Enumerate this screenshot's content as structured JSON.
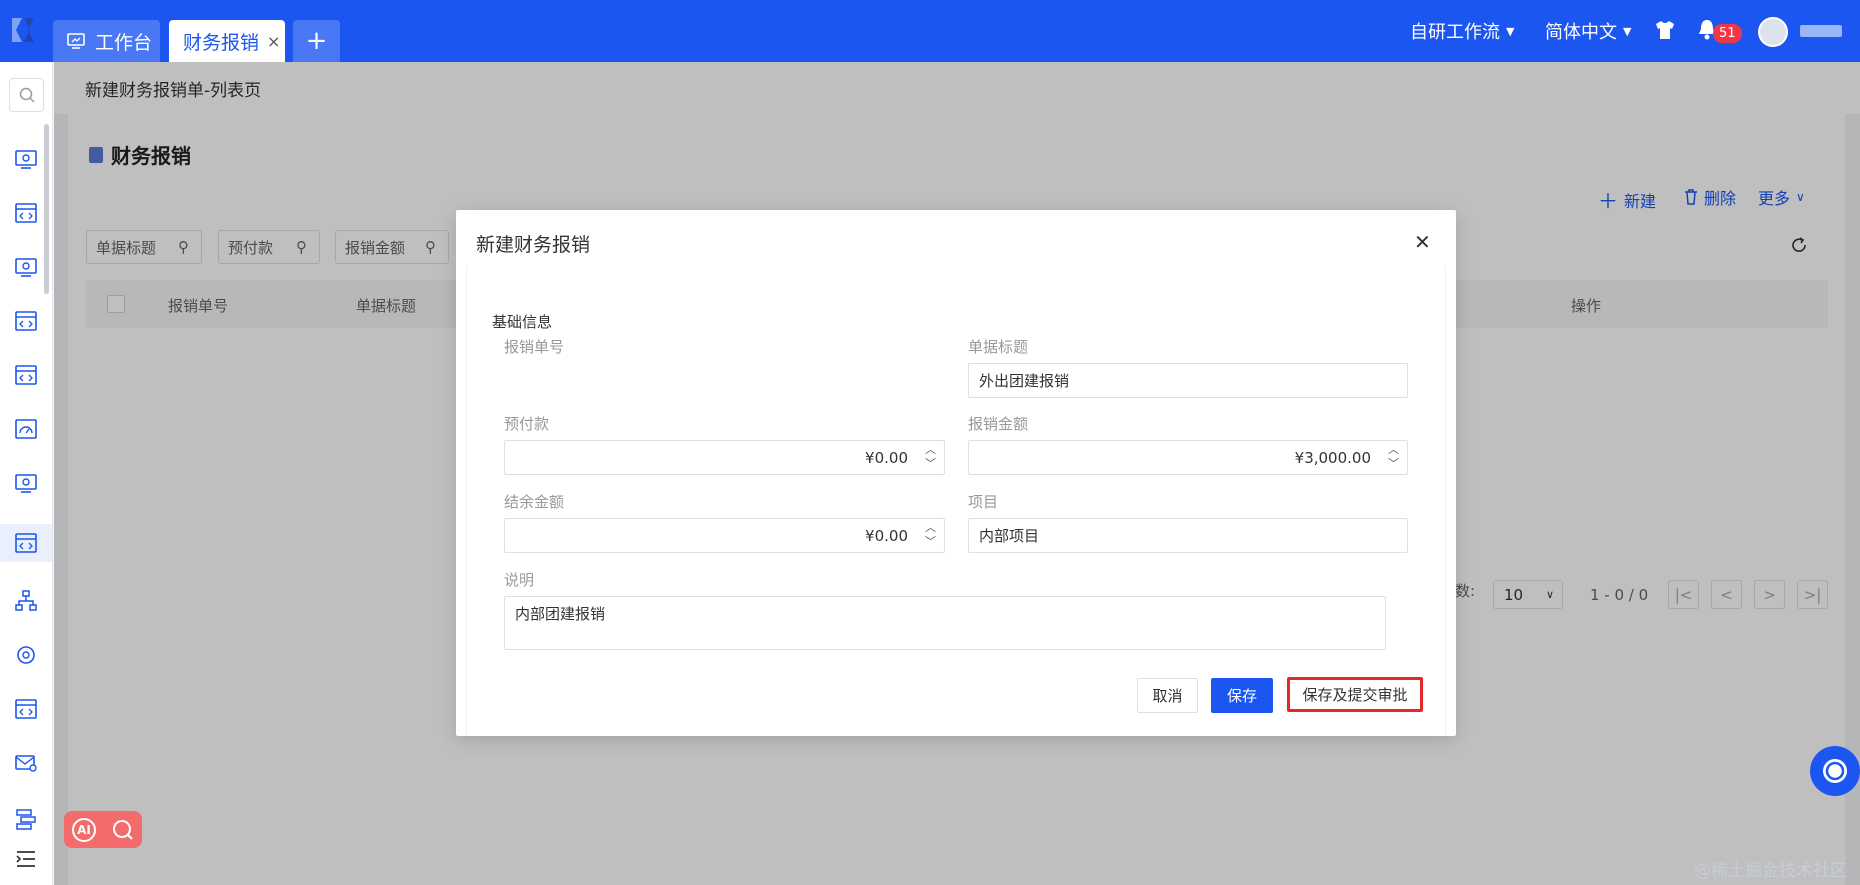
{
  "topbar": {
    "tabs": [
      {
        "label": "工作台"
      },
      {
        "label": "财务报销",
        "close": "×"
      },
      {
        "label": "+"
      }
    ],
    "workflow": "自研工作流",
    "language": "简体中文",
    "notifications_count": "51"
  },
  "breadcrumb": "新建财务报销单-列表页",
  "page": {
    "title": "财务报销",
    "actions": {
      "new": "新建",
      "delete": "删除",
      "more": "更多"
    },
    "filters": [
      "单据标题",
      "预付款",
      "报销金额"
    ],
    "columns": [
      "报销单号",
      "单据标题",
      "操作"
    ],
    "pagination": {
      "per_page_label": "数:",
      "per_page": "10",
      "range": "1 - 0 / 0"
    }
  },
  "modal": {
    "title": "新建财务报销",
    "section": "基础信息",
    "fields": {
      "reimburse_no": {
        "label": "报销单号"
      },
      "doc_title": {
        "label": "单据标题",
        "value": "外出团建报销"
      },
      "prepaid": {
        "label": "预付款",
        "value": "¥0.00"
      },
      "amount": {
        "label": "报销金额",
        "value": "¥3,000.00"
      },
      "balance": {
        "label": "结余金额",
        "value": "¥0.00"
      },
      "project": {
        "label": "项目",
        "value": "内部项目"
      },
      "desc": {
        "label": "说明",
        "value": "内部团建报销"
      }
    },
    "buttons": {
      "cancel": "取消",
      "save": "保存",
      "submit": "保存及提交审批"
    }
  },
  "ai_label": "AI",
  "watermark": "@稀土掘金技术社区",
  "colors": {
    "brand": "#1c56f0",
    "highlight": "#e5272b",
    "badge": "#f0374a"
  }
}
